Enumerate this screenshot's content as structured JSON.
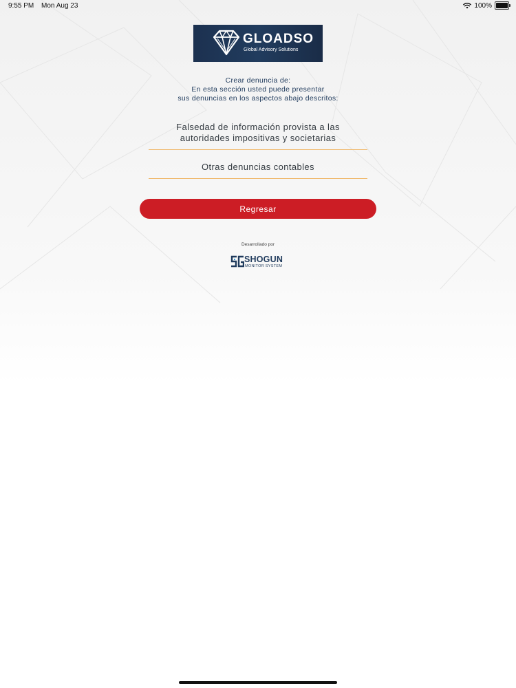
{
  "status_bar": {
    "time": "9:55 PM",
    "date": "Mon Aug 23",
    "battery": "100%",
    "wifi_icon": "wifi-icon",
    "battery_icon": "battery-icon"
  },
  "logo": {
    "name": "GLOADSO",
    "tagline": "Global Advisory Solutions",
    "icon": "diamond-icon"
  },
  "intro": {
    "line1": "Crear denuncia de:",
    "line2": "En esta sección usted puede presentar",
    "line3": "sus denuncias en los aspectos abajo descritos:"
  },
  "options": [
    {
      "line1": "Falsedad de información provista a las",
      "line2": "autoridades impositivas y societarias"
    },
    {
      "line1": "Otras denuncias contables"
    }
  ],
  "back_button": {
    "label": "Regresar"
  },
  "footer": {
    "developed_by": "Desarrollado por",
    "brand": "SHOGUN",
    "brand_sub": "MONITOR SYSTEM",
    "brand_icon": "sg-logo-icon"
  },
  "colors": {
    "accent": "#cc1d25",
    "primary_text": "#1f3a5c",
    "divider": "#f0b86a",
    "logo_background": "#1c3150"
  }
}
